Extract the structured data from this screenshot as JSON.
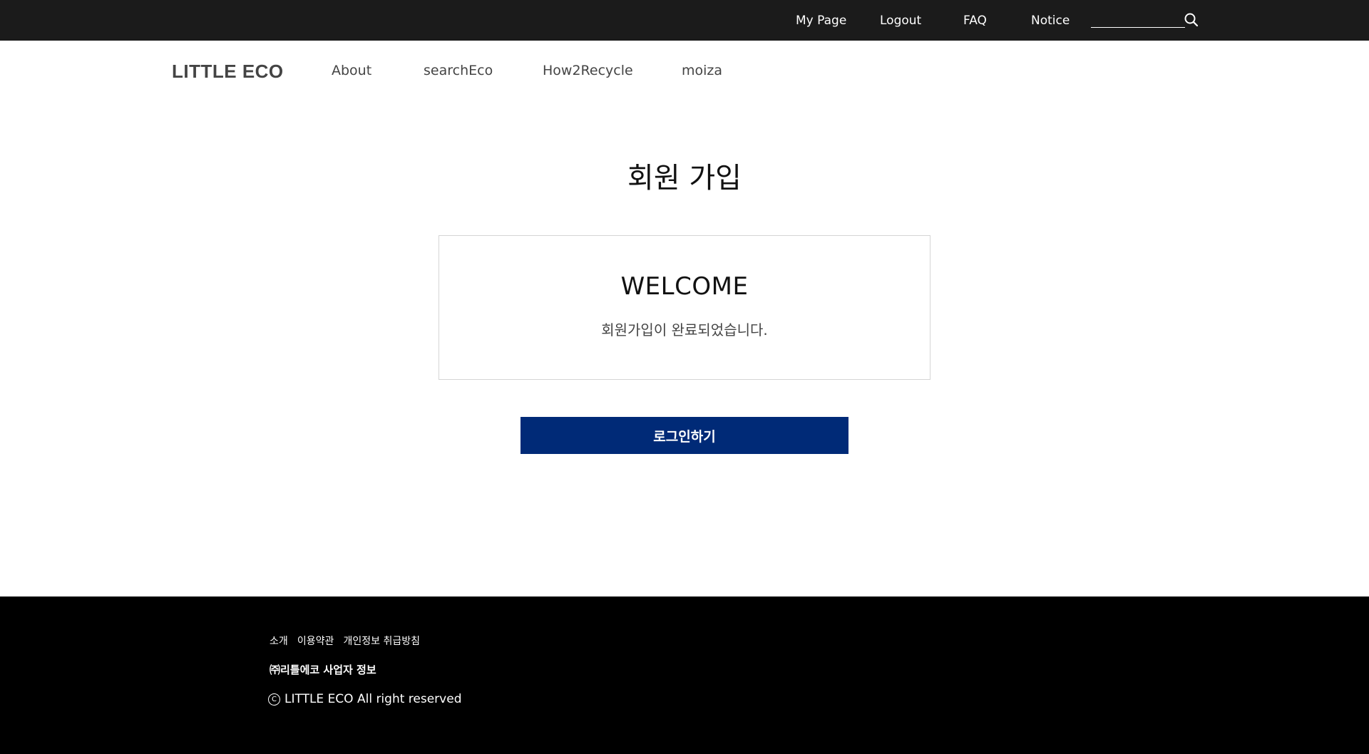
{
  "topbar": {
    "links": [
      "My Page",
      "Logout",
      "FAQ",
      "Notice"
    ],
    "search": {
      "value": "",
      "placeholder": ""
    }
  },
  "nav": {
    "logo": "LITTLE ECO",
    "items": [
      "About",
      "searchEco",
      "How2Recycle",
      "moiza"
    ]
  },
  "main": {
    "page_title": "회원 가입",
    "welcome_title": "WELCOME",
    "welcome_message": "회원가입이 완료되었습니다.",
    "login_button": "로그인하기"
  },
  "footer": {
    "links": [
      "소개",
      "이용약관",
      "개인정보 취급방침"
    ],
    "company_info": "㈜리틀에코 사업자 정보",
    "copyright_symbol": "C",
    "copyright": "LITTLE ECO  All right reserved"
  },
  "colors": {
    "topbar_bg": "#1b1b1b",
    "primary_button": "#002a77",
    "footer_bg": "#000000"
  }
}
